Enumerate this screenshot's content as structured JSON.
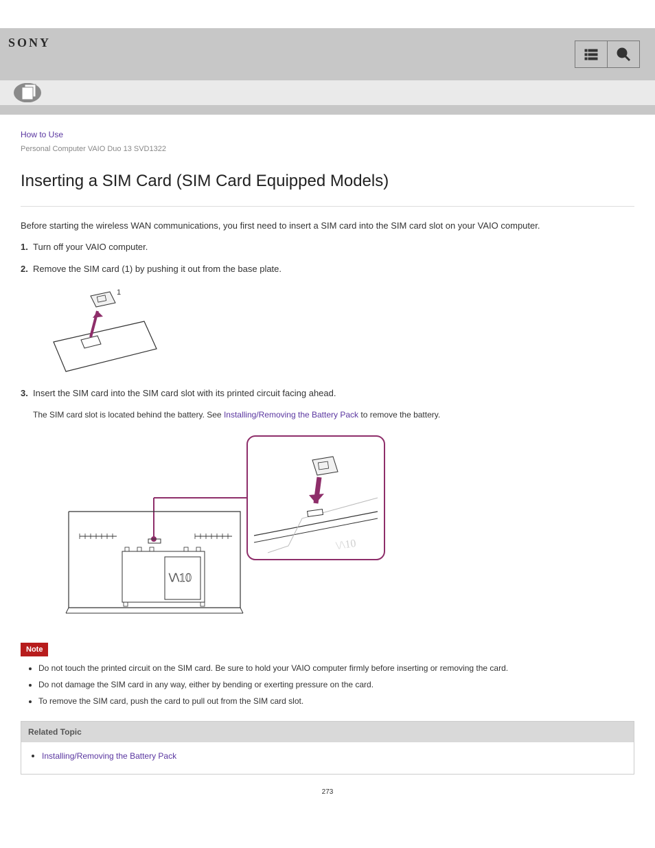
{
  "brand": "SONY",
  "breadcrumbs": "How to Use",
  "product_model": "Personal Computer  VAIO Duo 13  SVD1322",
  "title": "Inserting a SIM Card (SIM Card Equipped Models)",
  "intro": "Before starting the wireless WAN communications, you first need to insert a SIM card into the SIM card slot on your VAIO computer.",
  "step1": {
    "num": "1.",
    "text": "Turn off your VAIO computer."
  },
  "step2": {
    "num": "2.",
    "text": "Remove the SIM card (1) by pushing it out from the base plate.",
    "label1": "1"
  },
  "step3": {
    "num": "3.",
    "text": "Insert the SIM card into the SIM card slot with its printed circuit facing ahead.",
    "subtext": "The SIM card slot is located behind the battery. See Installing/Removing the Battery Pack to remove the battery."
  },
  "note_label": "Note",
  "notes": [
    "Do not touch the printed circuit on the SIM card. Be sure to hold your VAIO computer firmly before inserting or removing the card.",
    "Do not damage the SIM card in any way, either by bending or exerting pressure on the card.",
    "To remove the SIM card, push the card to pull out from the SIM card slot."
  ],
  "related_label": "Related Topic",
  "related_items": [
    "Installing/Removing the Battery Pack"
  ],
  "page_number": "273"
}
